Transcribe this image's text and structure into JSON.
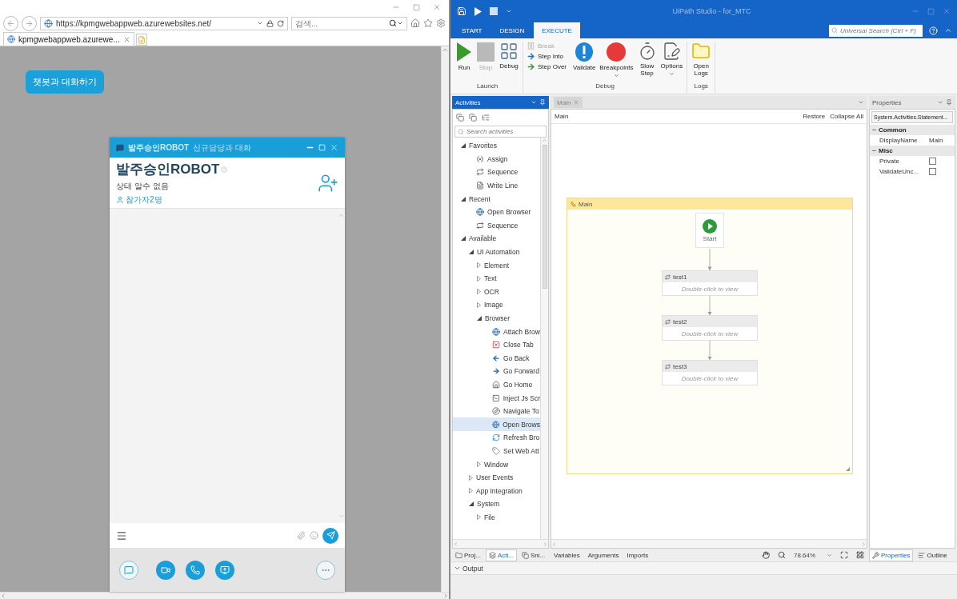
{
  "browser": {
    "url": "https://kpmgwebappweb.azurewebsites.net/",
    "search_placeholder": "검색...",
    "tab_title": "kpmgwebappweb.azurewe..."
  },
  "page": {
    "chat_button": "챗봇과 대화하기"
  },
  "chat_window": {
    "header_name": "발주승인ROBOT",
    "header_subtitle": "신규담당과 대화",
    "title": "발주승인ROBOT",
    "status": "상태 알수 없음",
    "participants": "참가자2명"
  },
  "studio": {
    "title": "UiPath Studio - for_MTC",
    "ribbon_tabs": [
      {
        "label": "START",
        "selected": false
      },
      {
        "label": "DESIGN",
        "selected": false
      },
      {
        "label": "EXECUTE",
        "selected": true
      }
    ],
    "search_placeholder": "Universal Search (Ctrl + F)",
    "ribbon_groups": [
      {
        "label": "Launch",
        "buttons": [
          {
            "label": "Run",
            "kind": "run",
            "disabled": false,
            "dropdown": false
          },
          {
            "label": "Stop",
            "kind": "stop",
            "disabled": true,
            "dropdown": false
          },
          {
            "label": "Debug",
            "kind": "debug",
            "disabled": false,
            "dropdown": false
          }
        ]
      },
      {
        "label": "Debug",
        "small_buttons": [
          {
            "label": "Break",
            "kind": "break",
            "disabled": true
          },
          {
            "label": "Step Into",
            "kind": "step-into",
            "disabled": false
          },
          {
            "label": "Step Over",
            "kind": "step-over",
            "disabled": false
          }
        ],
        "buttons": [
          {
            "label": "Validate",
            "kind": "validate",
            "disabled": false,
            "dropdown": false
          },
          {
            "label": "Breakpoints",
            "kind": "breakpoints",
            "disabled": false,
            "dropdown": true
          },
          {
            "label": "Slow Step",
            "kind": "slow-step",
            "disabled": false,
            "dropdown": false
          },
          {
            "label": "Options",
            "kind": "options",
            "disabled": false,
            "dropdown": true
          }
        ]
      },
      {
        "label": "Logs",
        "buttons": [
          {
            "label": "Open Logs",
            "kind": "logs",
            "disabled": false,
            "dropdown": false
          }
        ]
      }
    ],
    "activities": {
      "title": "Activities",
      "search_placeholder": "Search activities",
      "tree": [
        {
          "label": "Favorites",
          "kind": "group",
          "expanded": true,
          "selected": false,
          "children": [
            {
              "label": "Assign",
              "kind": "assign",
              "selected": false
            },
            {
              "label": "Sequence",
              "kind": "sequence",
              "selected": false
            },
            {
              "label": "Write Line",
              "kind": "log",
              "selected": false
            }
          ]
        },
        {
          "label": "Recent",
          "kind": "group",
          "expanded": true,
          "selected": false,
          "children": [
            {
              "label": "Open Browser",
              "kind": "browser",
              "selected": false
            },
            {
              "label": "Sequence",
              "kind": "sequence",
              "selected": false
            }
          ]
        },
        {
          "label": "Available",
          "kind": "group",
          "expanded": true,
          "selected": false,
          "children": [
            {
              "label": "UI Automation",
              "kind": "group",
              "expanded": true,
              "selected": false,
              "children": [
                {
                  "label": "Element",
                  "kind": "group",
                  "expanded": false,
                  "selected": false
                },
                {
                  "label": "Text",
                  "kind": "group",
                  "expanded": false,
                  "selected": false
                },
                {
                  "label": "OCR",
                  "kind": "group",
                  "expanded": false,
                  "selected": false
                },
                {
                  "label": "Image",
                  "kind": "group",
                  "expanded": false,
                  "selected": false
                },
                {
                  "label": "Browser",
                  "kind": "group",
                  "expanded": true,
                  "selected": false,
                  "children": [
                    {
                      "label": "Attach Brow",
                      "kind": "browser",
                      "selected": false
                    },
                    {
                      "label": "Close Tab",
                      "kind": "close",
                      "selected": false
                    },
                    {
                      "label": "Go Back",
                      "kind": "back",
                      "selected": false
                    },
                    {
                      "label": "Go Forward",
                      "kind": "forward",
                      "selected": false
                    },
                    {
                      "label": "Go Home",
                      "kind": "home",
                      "selected": false
                    },
                    {
                      "label": "Inject Js Scr",
                      "kind": "script",
                      "selected": false
                    },
                    {
                      "label": "Navigate To",
                      "kind": "navigate",
                      "selected": false
                    },
                    {
                      "label": "Open Brows",
                      "kind": "browser",
                      "selected": true
                    },
                    {
                      "label": "Refresh Bro",
                      "kind": "refresh",
                      "selected": false
                    },
                    {
                      "label": "Set Web Att",
                      "kind": "attribute",
                      "selected": false
                    }
                  ]
                },
                {
                  "label": "Window",
                  "kind": "group",
                  "expanded": false,
                  "selected": false
                }
              ]
            },
            {
              "label": "User Events",
              "kind": "group",
              "expanded": false,
              "selected": false
            },
            {
              "label": "App Integration",
              "kind": "group",
              "expanded": false,
              "selected": false
            },
            {
              "label": "System",
              "kind": "group",
              "expanded": true,
              "selected": false,
              "children": [
                {
                  "label": "File",
                  "kind": "group",
                  "expanded": false,
                  "selected": false
                }
              ]
            }
          ]
        }
      ]
    },
    "left_tabs": [
      {
        "label": "Proj...",
        "kind": "project",
        "selected": false
      },
      {
        "label": "Acti...",
        "kind": "activities",
        "selected": true
      },
      {
        "label": "Sni...",
        "kind": "snippets",
        "selected": false
      }
    ],
    "designer": {
      "tab": "Main",
      "breadcrumb": "Main",
      "actions": [
        "Restore",
        "Collapse All"
      ],
      "flowchart": {
        "title": "Main",
        "start": "Start",
        "nodes": [
          {
            "title": "test1",
            "hint": "Double-click to view"
          },
          {
            "title": "test2",
            "hint": "Double-click to view"
          },
          {
            "title": "test3",
            "hint": "Double-click to view"
          }
        ]
      },
      "bottom_tabs": [
        "Variables",
        "Arguments",
        "Imports"
      ],
      "zoom": "78.64%"
    },
    "properties": {
      "title": "Properties",
      "type": "System.Activities.Statement...",
      "categories": [
        {
          "name": "Common",
          "expanded": true,
          "rows": [
            {
              "name": "DisplayName",
              "kind": "text",
              "value": "Main"
            }
          ]
        },
        {
          "name": "Misc",
          "expanded": true,
          "rows": [
            {
              "name": "Private",
              "kind": "checkbox",
              "checked": false
            },
            {
              "name": "ValidateUnc...",
              "kind": "checkbox",
              "checked": false
            }
          ]
        }
      ]
    },
    "right_tabs": [
      {
        "label": "Properties",
        "kind": "properties",
        "selected": true
      },
      {
        "label": "Outline",
        "kind": "outline",
        "selected": false
      }
    ],
    "output": "Output"
  }
}
